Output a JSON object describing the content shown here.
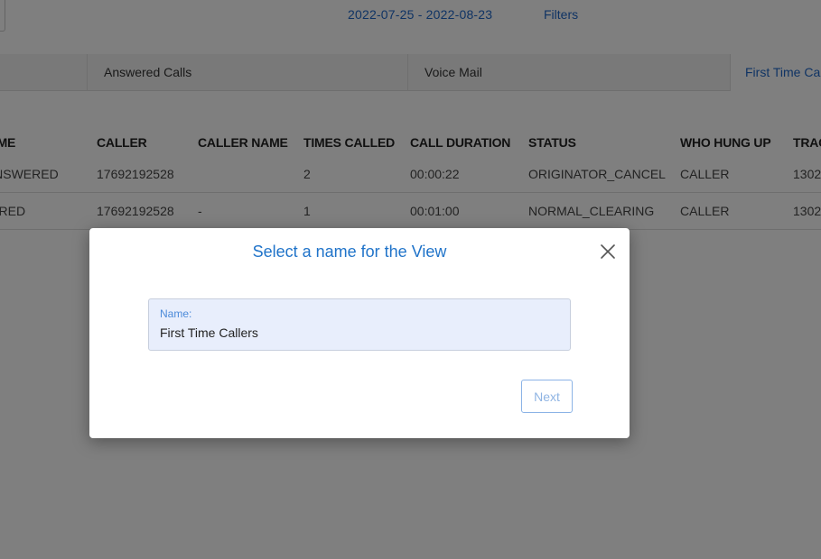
{
  "topbar": {
    "date_range": "2022-07-25 - 2022-08-23",
    "filters_label": "Filters"
  },
  "tabs": [
    {
      "label": ""
    },
    {
      "label": "Answered Calls"
    },
    {
      "label": "Voice Mail"
    },
    {
      "label": "First Time Ca"
    }
  ],
  "table": {
    "headers": {
      "outcome": "COME",
      "caller": "CALLER",
      "caller_name": "CALLER NAME",
      "times_called": "TIMES CALLED",
      "call_duration": "CALL DURATION",
      "status": "STATUS",
      "who_hung_up": "WHO HUNG UP",
      "tracking": "TRAC"
    },
    "rows": [
      {
        "outcome": "_ANSWERED",
        "caller": "17692192528",
        "caller_name": "",
        "times_called": "2",
        "call_duration": "00:00:22",
        "status": "ORIGINATOR_CANCEL",
        "who_hung_up": "CALLER",
        "tracking": "1302"
      },
      {
        "outcome": "WERED",
        "caller": "17692192528",
        "caller_name": "-",
        "times_called": "1",
        "call_duration": "00:01:00",
        "status": "NORMAL_CLEARING",
        "who_hung_up": "CALLER",
        "tracking": "1302"
      }
    ]
  },
  "modal": {
    "title": "Select a name for the View",
    "name_label": "Name:",
    "name_value": "First Time Callers",
    "next_label": "Next",
    "close_icon": "close-icon"
  },
  "colors": {
    "accent": "#1f67c8",
    "overlay": "rgba(0,0,0,0.5)",
    "input_bg": "#e8eefc"
  }
}
